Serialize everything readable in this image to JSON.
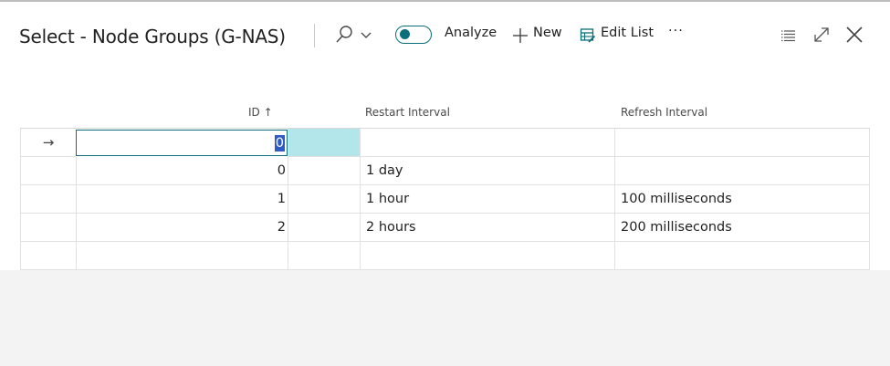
{
  "window": {
    "title": "Select - Node Groups (G-NAS)"
  },
  "toolbar": {
    "search_icon": "search-icon",
    "analyze_label": "Analyze",
    "analyze_on": false,
    "new_label": "New",
    "edit_list_label": "Edit List",
    "more_label": "···"
  },
  "header_actions": {
    "list_icon": "list-view-icon",
    "expand_icon": "expand-icon",
    "close_icon": "close-icon"
  },
  "colors": {
    "accent": "#0a6f7a",
    "selection_fill": "#b3e6ea",
    "text_selection": "#2f5cc4"
  },
  "table": {
    "columns": [
      "ID",
      "Restart Interval",
      "Refresh Interval"
    ],
    "sort_indicator": "↑",
    "new_row": {
      "indicator": "→",
      "id_value": "0"
    },
    "rows": [
      {
        "id": "0",
        "restart": "1 day",
        "refresh": ""
      },
      {
        "id": "1",
        "restart": "1 hour",
        "refresh": "100 milliseconds"
      },
      {
        "id": "2",
        "restart": "2 hours",
        "refresh": "200 milliseconds"
      }
    ]
  }
}
